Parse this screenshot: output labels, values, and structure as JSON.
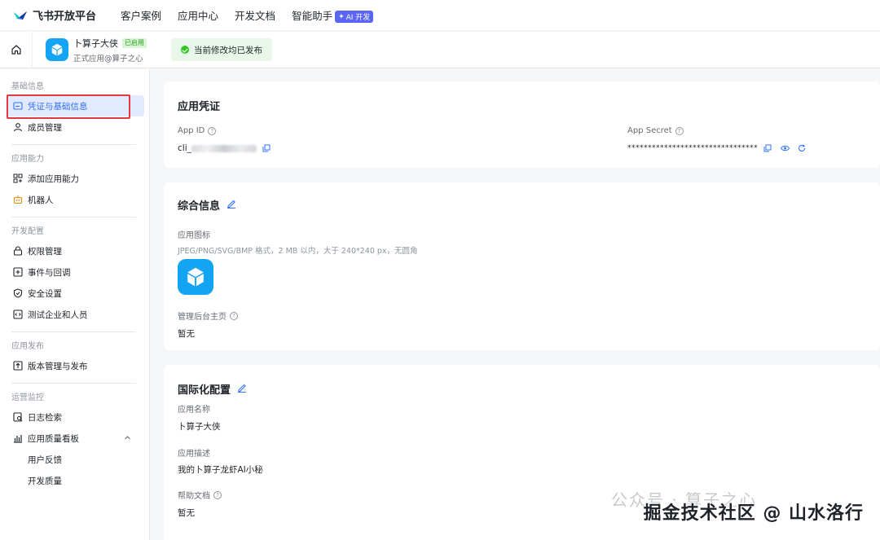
{
  "topnav": {
    "brand": "飞书开放平台",
    "items": [
      "客户案例",
      "应用中心",
      "开发文档",
      "智能助手"
    ],
    "ai_badge": "AI 开发"
  },
  "subheader": {
    "app_name": "卜算子大侠",
    "app_tag": "已启用",
    "app_sub": "正式应用@算子之心",
    "publish_status": "当前修改均已发布"
  },
  "sidebar": {
    "groups": [
      {
        "title": "基础信息",
        "items": [
          "凭证与基础信息",
          "成员管理"
        ]
      },
      {
        "title": "应用能力",
        "items": [
          "添加应用能力",
          "机器人"
        ]
      },
      {
        "title": "开发配置",
        "items": [
          "权限管理",
          "事件与回调",
          "安全设置",
          "测试企业和人员"
        ]
      },
      {
        "title": "应用发布",
        "items": [
          "版本管理与发布"
        ]
      },
      {
        "title": "运营监控",
        "items": [
          "日志检索",
          "应用质量看板",
          "用户反馈",
          "开发质量"
        ]
      }
    ]
  },
  "credentials": {
    "title": "应用凭证",
    "app_id_label": "App ID",
    "app_id_prefix": "cli_",
    "app_secret_label": "App Secret",
    "app_secret_value": "********************************"
  },
  "general": {
    "title": "综合信息",
    "icon_label": "应用图标",
    "icon_hint": "JPEG/PNG/SVG/BMP 格式，2 MB 以内，大于 240*240 px，无圆角",
    "admin_label": "管理后台主页",
    "admin_value": "暂无"
  },
  "i18n": {
    "title": "国际化配置",
    "name_label": "应用名称",
    "name_value": "卜算子大侠",
    "desc_label": "应用描述",
    "desc_value": "我的卜算子龙虾AI小秘",
    "help_label": "帮助文档",
    "help_value": "暂无"
  },
  "watermark": {
    "faint": "公众号 · 算子之心",
    "main": "掘金技术社区 @ 山水洛行"
  },
  "colors": {
    "accent": "#3370ff",
    "brand_icon": "#14a4f4",
    "highlight": "#e0393e"
  }
}
